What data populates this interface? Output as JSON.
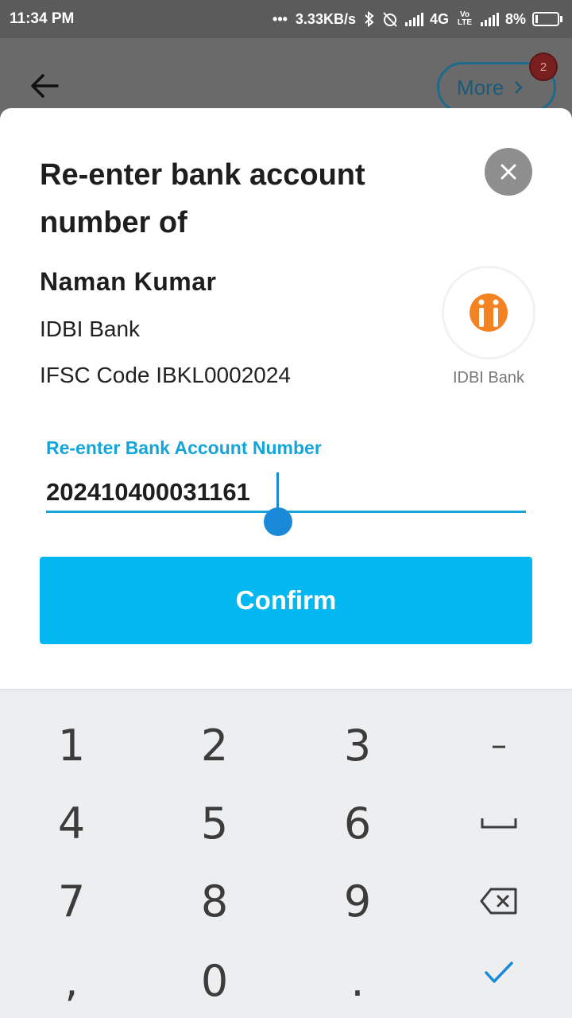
{
  "status_bar": {
    "time": "11:34 PM",
    "dots": "•••",
    "net_speed": "3.33KB/s",
    "network": "4G",
    "volte": "Vo LTE",
    "battery": "8%"
  },
  "header": {
    "more_label": "More",
    "more_badge": "2"
  },
  "sheet": {
    "title": "Re-enter bank account number of",
    "payee_name": "Naman Kumar",
    "bank_name": "IDBI Bank",
    "ifsc": "IFSC Code IBKL0002024",
    "logo_caption": "IDBI Bank",
    "field_label": "Re-enter Bank Account Number",
    "field_value": "202410400031161",
    "confirm_label": "Confirm"
  },
  "keypad": {
    "keys": [
      "1",
      "2",
      "3",
      "–",
      "4",
      "5",
      "6",
      "␣",
      "7",
      "8",
      "9",
      "⌫",
      ",",
      "0",
      ".",
      "✓"
    ]
  },
  "colors": {
    "accent": "#03b8f0",
    "label_blue": "#14a5d8",
    "logo_orange": "#f58220"
  }
}
